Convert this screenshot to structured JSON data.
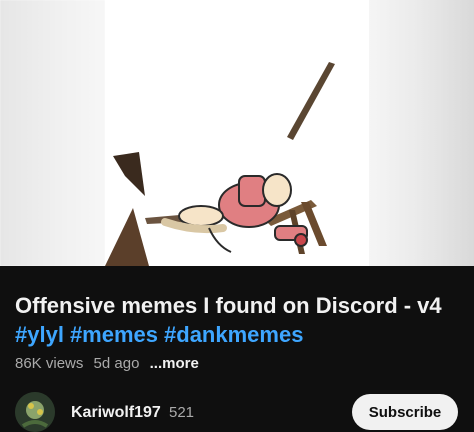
{
  "video": {
    "title": "Offensive memes I found on Discord - v4",
    "hashtags": [
      "#ylyl",
      "#memes",
      "#dankmemes"
    ],
    "views": "86K views",
    "age": "5d ago",
    "more_label": "...more"
  },
  "channel": {
    "name": "Kariwolf197",
    "subscriber_count": "521",
    "subscribe_label": "Subscribe"
  },
  "colors": {
    "background": "#0f0f0f",
    "hashtag": "#3ea6ff",
    "subscribe_bg": "#f1f1f1"
  }
}
